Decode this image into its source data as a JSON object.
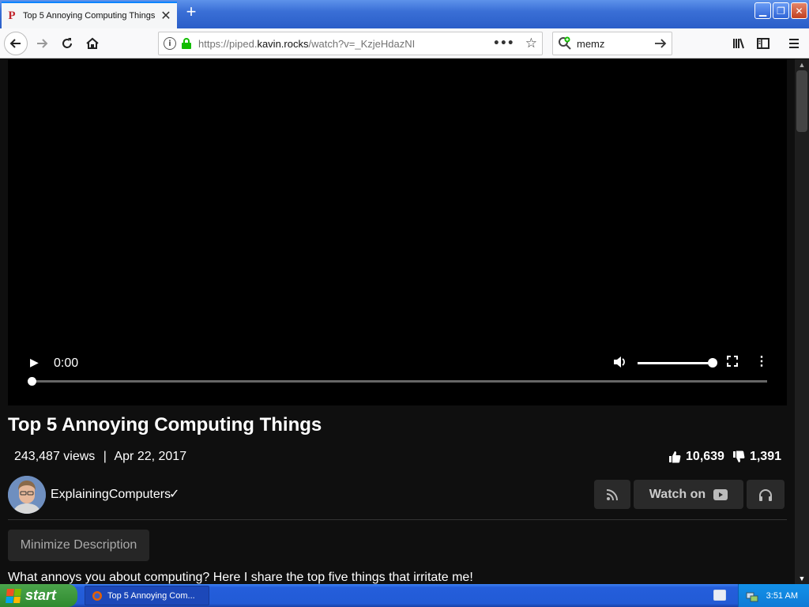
{
  "browser": {
    "tab": {
      "title": "Top 5 Annoying Computing Things",
      "favicon": "P"
    },
    "url": {
      "prefix": "https://piped.",
      "host": "kavin.rocks",
      "path": "/watch?v=_KzjeHdazNI"
    },
    "search": {
      "value": "memz"
    }
  },
  "player": {
    "time": "0:00",
    "progress": 0,
    "volume": 1.0
  },
  "video": {
    "title": "Top 5 Annoying Computing Things",
    "views": "243,487 views",
    "separator": "|",
    "date": "Apr 22, 2017",
    "likes": "10,639",
    "dislikes": "1,391"
  },
  "channel": {
    "name": "ExplainingComputers",
    "verified_mark": "✓"
  },
  "buttons": {
    "watch_on": "Watch on",
    "minimize_description": "Minimize Description"
  },
  "description": "What annoys you about computing? Here I share the top five things that irritate me!",
  "taskbar": {
    "start": "start",
    "task_title": "Top 5 Annoying Com...",
    "clock": "3:51 AM"
  },
  "colors": {
    "accent": "#0a84ff",
    "page_bg": "#0f0f0f",
    "xp_blue": "#245edb",
    "xp_green": "#3c9a3c"
  }
}
